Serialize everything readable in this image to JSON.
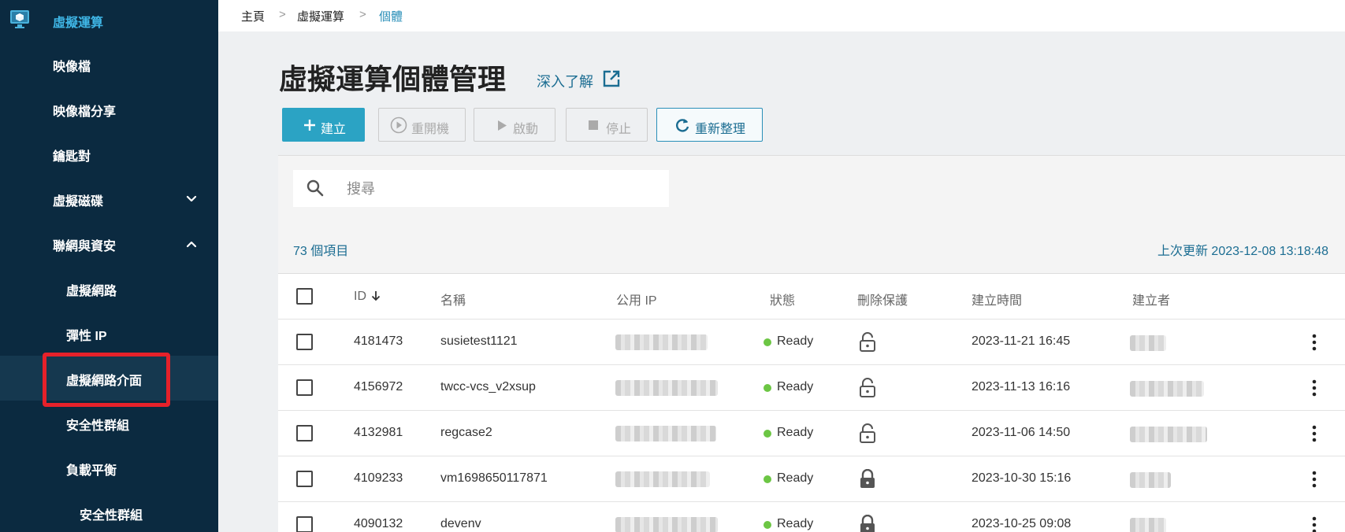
{
  "sidebar": {
    "top_label": "虛擬運算",
    "items": [
      {
        "label": "映像檔",
        "level": 1
      },
      {
        "label": "映像檔分享",
        "level": 1
      },
      {
        "label": "鑰匙對",
        "level": 1
      },
      {
        "label": "虛擬磁碟",
        "level": 1,
        "chevron": "chevron-down-icon"
      },
      {
        "label": "聯網與資安",
        "level": 1,
        "chevron": "chevron-up-icon"
      },
      {
        "label": "虛擬網路",
        "level": 2
      },
      {
        "label": "彈性 IP",
        "level": 2
      },
      {
        "label": "虛擬網路介面",
        "level": 2,
        "active": true
      },
      {
        "label": "安全性群組",
        "level": 2
      },
      {
        "label": "負載平衡",
        "level": 2
      },
      {
        "label": "安全性群組",
        "level": 3
      }
    ]
  },
  "breadcrumb": {
    "home": "主頁",
    "sep": ">",
    "section": "虛擬運算",
    "current": "個體"
  },
  "page": {
    "title": "虛擬運算個體管理",
    "learn_more": "深入了解"
  },
  "toolbar": {
    "create": "建立",
    "reboot": "重開機",
    "start": "啟動",
    "stop": "停止",
    "refresh": "重新整理"
  },
  "search": {
    "placeholder": "搜尋"
  },
  "summary": {
    "count": "73 個項目",
    "last_update": "上次更新 2023-12-08 13:18:48"
  },
  "table": {
    "columns": {
      "id": "ID",
      "name": "名稱",
      "ip": "公用 IP",
      "status": "狀態",
      "protect": "刪除保護",
      "created": "建立時間",
      "creator": "建立者"
    },
    "rows": [
      {
        "id": "4181473",
        "name": "susietest1121",
        "status": "Ready",
        "locked": false,
        "created": "2023-11-21 16:45"
      },
      {
        "id": "4156972",
        "name": "twcc-vcs_v2xsup",
        "status": "Ready",
        "locked": false,
        "created": "2023-11-13 16:16"
      },
      {
        "id": "4132981",
        "name": "regcase2",
        "status": "Ready",
        "locked": false,
        "created": "2023-11-06 14:50"
      },
      {
        "id": "4109233",
        "name": "vm1698650117871",
        "status": "Ready",
        "locked": true,
        "created": "2023-10-30 15:16"
      },
      {
        "id": "4090132",
        "name": "devenv",
        "status": "Ready",
        "locked": true,
        "created": "2023-10-25 09:08"
      }
    ]
  },
  "colors": {
    "sidebar_bg": "#0b2a40",
    "accent": "#2ba3c4",
    "link": "#1b6d92",
    "ready": "#6cc644",
    "highlight": "#e6212a"
  }
}
